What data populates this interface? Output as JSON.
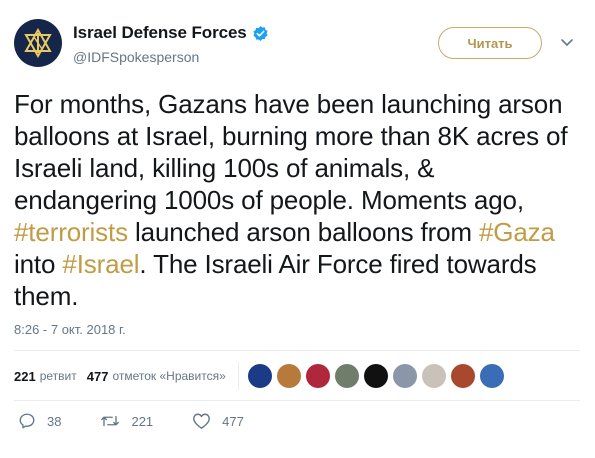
{
  "account": {
    "display_name": "Israel Defense Forces",
    "handle": "@IDFSpokesperson",
    "follow_label": "Читать"
  },
  "tweet": {
    "t1": "For months, Gazans have been launching arson balloons at Israel, burning more than 8K acres of Israeli land, killing 100s of animals, & endangering 1000s of people. Moments ago, ",
    "h1": "#terrorists",
    "t2": " launched arson balloons from ",
    "h2": "#Gaza",
    "t3": " into ",
    "h3": "#Israel",
    "t4": ". The Israeli Air Force fired towards them."
  },
  "timestamp": "8:26 - 7 окт. 2018 г.",
  "stats": {
    "retweets_count": "221",
    "retweets_label": "ретвит",
    "likes_count": "477",
    "likes_label": "отметок «Нравится»"
  },
  "likers": [
    {
      "color": "#1b3b86"
    },
    {
      "color": "#b77a3a"
    },
    {
      "color": "#b0263a"
    },
    {
      "color": "#6f7d6a"
    },
    {
      "color": "#111111"
    },
    {
      "color": "#8a97a8"
    },
    {
      "color": "#c9c2b9"
    },
    {
      "color": "#a8482f"
    },
    {
      "color": "#3a6db5"
    }
  ],
  "actions": {
    "reply_count": "38",
    "retweet_count": "221",
    "like_count": "477"
  },
  "colors": {
    "hashtag": "#c09c44",
    "follow_border": "#c8a96c",
    "verified": "#1da1f2"
  }
}
